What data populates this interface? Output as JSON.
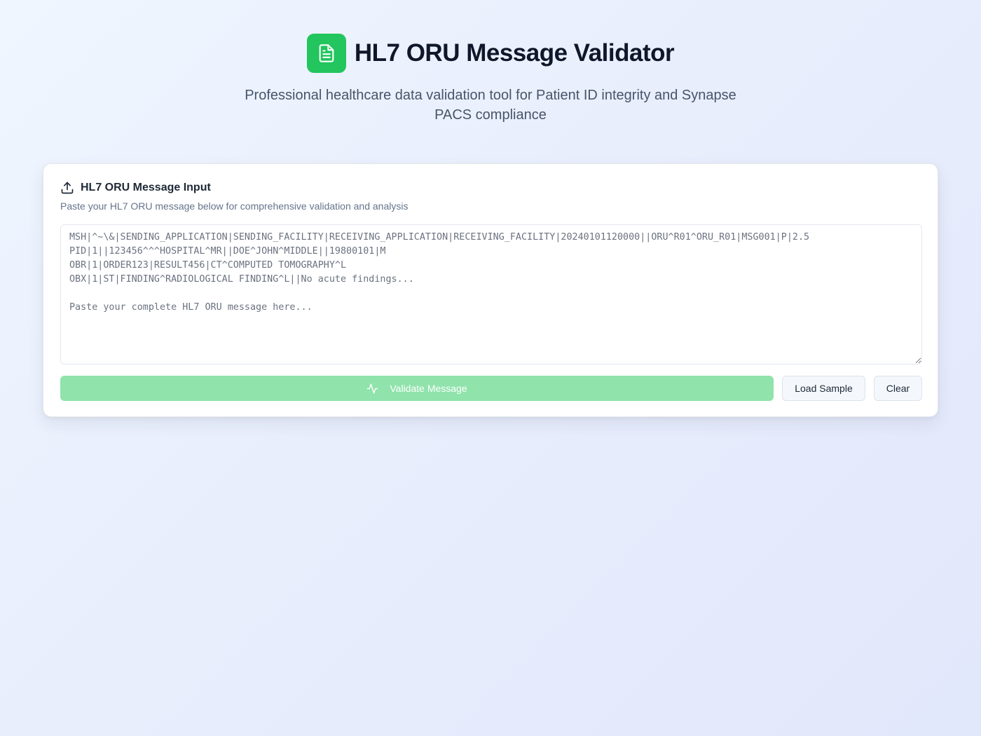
{
  "header": {
    "title": "HL7 ORU Message Validator",
    "subtitle": "Professional healthcare data validation tool for Patient ID integrity and Synapse PACS compliance",
    "logo_icon": "file-text-icon"
  },
  "input_card": {
    "title": "HL7 ORU Message Input",
    "title_icon": "upload-icon",
    "description": "Paste your HL7 ORU message below for comprehensive validation and analysis",
    "textarea_placeholder": "MSH|^~\\&|SENDING_APPLICATION|SENDING_FACILITY|RECEIVING_APPLICATION|RECEIVING_FACILITY|20240101120000||ORU^R01^ORU_R01|MSG001|P|2.5\nPID|1||123456^^^HOSPITAL^MR||DOE^JOHN^MIDDLE||19800101|M\nOBR|1|ORDER123|RESULT456|CT^COMPUTED TOMOGRAPHY^L\nOBX|1|ST|FINDING^RADIOLOGICAL FINDING^L||No acute findings...\n\nPaste your complete HL7 ORU message here...",
    "textarea_value": ""
  },
  "actions": {
    "validate_label": "Validate Message",
    "validate_icon": "activity-icon",
    "load_sample_label": "Load Sample",
    "clear_label": "Clear"
  },
  "colors": {
    "accent": "#22c55e",
    "validate_disabled": "#8fe3ab",
    "title": "#0f172a",
    "subtitle": "#475569"
  }
}
